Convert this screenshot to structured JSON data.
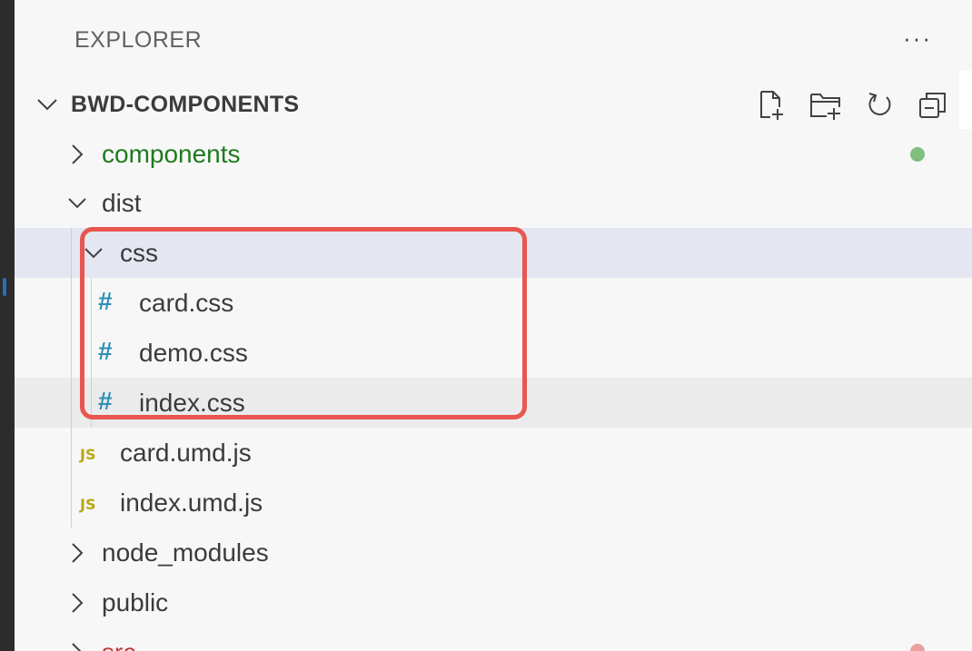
{
  "explorer": {
    "title": "EXPLORER",
    "more_label": "···"
  },
  "workspace": {
    "name": "BWD-COMPONENTS",
    "actions": [
      {
        "name": "new-file-icon"
      },
      {
        "name": "new-folder-icon"
      },
      {
        "name": "refresh-icon"
      },
      {
        "name": "collapse-all-icon"
      }
    ]
  },
  "tree": {
    "components": {
      "label": "components",
      "status_color": "#7fbf7f",
      "label_color": "#1f7a1f"
    },
    "dist": {
      "label": "dist"
    },
    "css": {
      "label": "css"
    },
    "card_css": {
      "label": "card.css",
      "icon": "css-hash-icon"
    },
    "demo_css": {
      "label": "demo.css",
      "icon": "css-hash-icon"
    },
    "index_css": {
      "label": "index.css",
      "icon": "css-hash-icon"
    },
    "card_umd": {
      "label": "card.umd.js",
      "badge": "JS"
    },
    "index_umd": {
      "label": "index.umd.js",
      "badge": "JS"
    },
    "node_modules": {
      "label": "node_modules"
    },
    "public": {
      "label": "public"
    },
    "src": {
      "label": "src",
      "status_color": "#e8a0a0",
      "label_color": "#c73a3a"
    }
  },
  "colors": {
    "highlight_border": "#e8564f",
    "selected_row": "#e4e6f1",
    "hover_row": "#ebebeb",
    "css_icon": "#2f8fb4",
    "js_badge": "#b8a615"
  }
}
